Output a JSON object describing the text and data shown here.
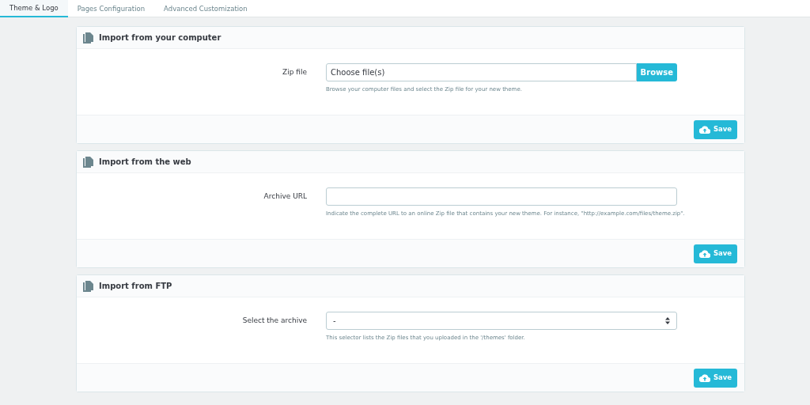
{
  "tabs": [
    {
      "label": "Theme & Logo",
      "selected": true
    },
    {
      "label": "Pages Configuration",
      "selected": false
    },
    {
      "label": "Advanced Customization",
      "selected": false
    }
  ],
  "panels": [
    {
      "title": "Import from your computer",
      "field": {
        "kind": "file",
        "label": "Zip file",
        "value": "Choose file(s)",
        "button": "Browse",
        "help": "Browse your computer files and select the Zip file for your new theme."
      },
      "save": "Save"
    },
    {
      "title": "Import from the web",
      "field": {
        "kind": "text",
        "label": "Archive URL",
        "help": "Indicate the complete URL to an online Zip file that contains your new theme. For instance, \"http://example.com/files/theme.zip\"."
      },
      "save": "Save"
    },
    {
      "title": "Import from FTP",
      "field": {
        "kind": "select",
        "label": "Select the archive",
        "value": "-",
        "help": "This selector lists the Zip files that you uploaded in the '/themes' folder."
      },
      "save": "Save"
    }
  ]
}
